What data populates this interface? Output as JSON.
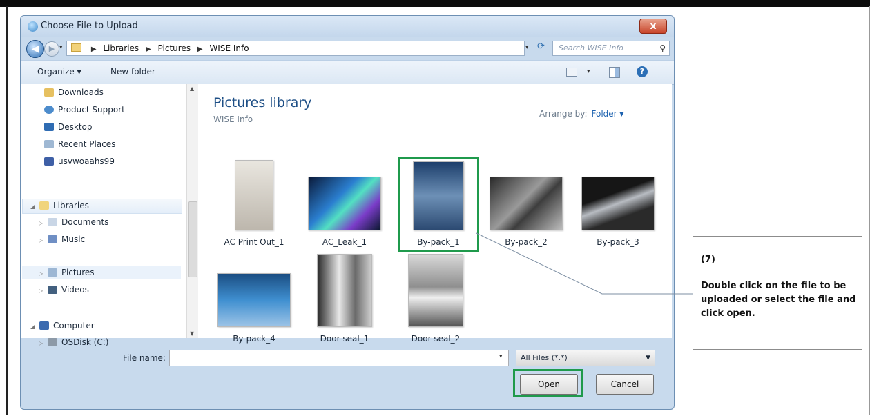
{
  "dialog": {
    "title": "Choose File to Upload",
    "close_label": "x"
  },
  "address": {
    "breadcrumbs": [
      "Libraries",
      "Pictures",
      "WISE Info"
    ],
    "search_placeholder": "Search WISE Info"
  },
  "toolbar": {
    "organize_label": "Organize ▾",
    "new_folder_label": "New folder",
    "help_label": "?"
  },
  "nav": {
    "favorites": [
      {
        "label": "Downloads",
        "icon": "downloads-folder-icon"
      },
      {
        "label": "Product Support",
        "icon": "product-support-icon"
      },
      {
        "label": "Desktop",
        "icon": "desktop-icon"
      },
      {
        "label": "Recent Places",
        "icon": "recent-places-icon"
      },
      {
        "label": "usvwoaahs99",
        "icon": "network-icon"
      }
    ],
    "libraries_label": "Libraries",
    "libraries": [
      {
        "label": "Documents",
        "icon": "documents-icon"
      },
      {
        "label": "Music",
        "icon": "music-icon"
      },
      {
        "label": "Pictures",
        "icon": "pictures-icon"
      },
      {
        "label": "Videos",
        "icon": "videos-icon"
      }
    ],
    "computer_label": "Computer",
    "drives": [
      {
        "label": "OSDisk (C:)",
        "icon": "disk-drive-icon"
      }
    ]
  },
  "content": {
    "title": "Pictures library",
    "subtitle": "WISE Info",
    "arrange_label": "Arrange by:",
    "arrange_value": "Folder ▾",
    "files": [
      {
        "name": "AC Print Out_1"
      },
      {
        "name": "AC_Leak_1"
      },
      {
        "name": "By-pack_1"
      },
      {
        "name": "By-pack_2"
      },
      {
        "name": "By-pack_3"
      },
      {
        "name": "By-pack_4"
      },
      {
        "name": "Door seal_1"
      },
      {
        "name": "Door seal_2"
      }
    ]
  },
  "footer": {
    "file_name_label": "File name:",
    "file_name_value": "",
    "filter_value": "All Files (*.*)",
    "open_label": "Open",
    "cancel_label": "Cancel"
  },
  "callout": {
    "step": "(7)",
    "message": "Double click on the file to be uploaded or select the file and click open."
  },
  "colors": {
    "highlight": "#1f9a4c",
    "accent": "#1e4f86"
  }
}
